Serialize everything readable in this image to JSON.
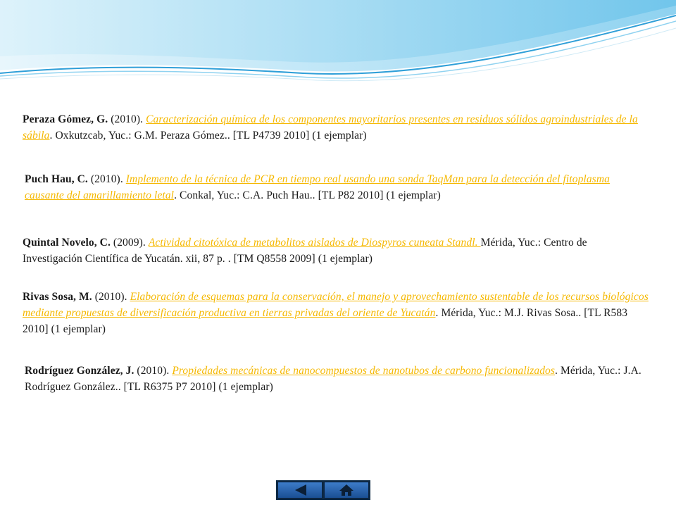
{
  "colors": {
    "link": "#f5b800",
    "text": "#1a1a1a",
    "wave_light": "#bfe6f7",
    "wave_accent": "#2f9fd8",
    "nav_button": "#2a63ad"
  },
  "entries": [
    {
      "author": "Peraza Gómez, G.",
      "year": " (2010). ",
      "title": "Caracterización química de los componentes mayoritarios presentes en residuos sólidos agroindustriales de la sábila",
      "rest": ". Oxkutzcab, Yuc.: G.M. Peraza Gómez.. [TL P4739 2010] (1 ejemplar)"
    },
    {
      "author": "Puch Hau, C.",
      "year": " (2010). ",
      "title": "Implemento de la técnica de PCR en tiempo real usando una sonda TaqMan para la detección del fitoplasma causante del amarillamiento letal",
      "rest": ". Conkal, Yuc.: C.A. Puch Hau.. [TL P82 2010] (1 ejemplar)"
    },
    {
      "author": "Quintal Novelo, C.",
      "year": " (2009). ",
      "title": "Actividad citotóxica de metabolitos aislados de Diospyros cuneata Standl. ",
      "rest": "Mérida, Yuc.: Centro de Investigación Científica de Yucatán. xii, 87 p. . [TM Q8558 2009] (1 ejemplar)"
    },
    {
      "author": "Rivas Sosa, M.",
      "year": " (2010). ",
      "title": "Elaboración de esquemas para la conservación, el manejo y aprovechamiento sustentable de los recursos biológicos mediante propuestas de diversificación productiva en tierras privadas del oriente de Yucatán",
      "rest": ". Mérida, Yuc.: M.J. Rivas Sosa.. [TL R583 2010] (1 ejemplar)"
    },
    {
      "author": "Rodríguez González, J.",
      "year": " (2010). ",
      "title": "Propiedades mecánicas de nanocompuestos de nanotubos de carbono funcionalizados",
      "rest": ". Mérida, Yuc.: J.A. Rodríguez González.. [TL R6375 P7 2010] (1 ejemplar)"
    }
  ],
  "navigation": {
    "buttons": [
      {
        "icon": "back-arrow-icon"
      },
      {
        "icon": "home-icon"
      }
    ]
  }
}
